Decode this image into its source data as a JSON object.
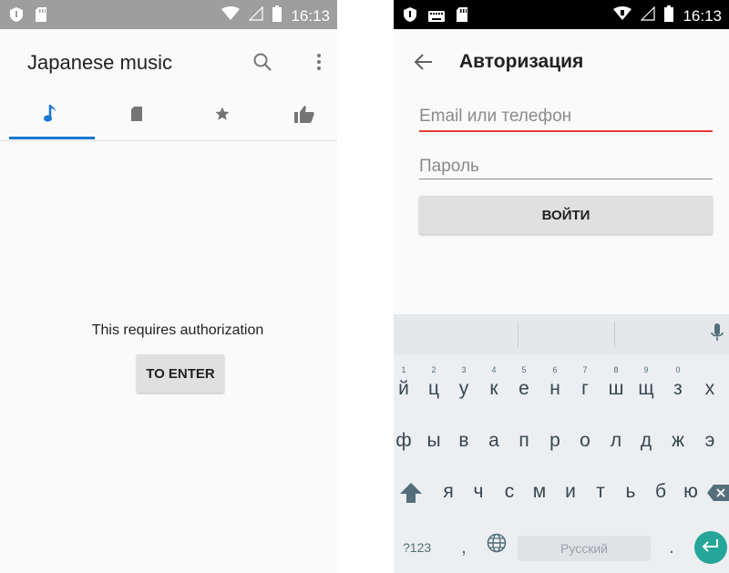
{
  "left": {
    "status_time": "16:13",
    "title": "Japanese music",
    "tabs": [
      {
        "icon": "music-note-icon"
      },
      {
        "icon": "sd-card-icon"
      },
      {
        "icon": "star-icon"
      },
      {
        "icon": "thumb-up-icon"
      }
    ],
    "message": "This requires authorization",
    "button_label": "TO ENTER",
    "accent": "#1976d2"
  },
  "right": {
    "status_time": "16:13",
    "title": "Авторизация",
    "email_placeholder": "Email или телефон",
    "password_placeholder": "Пароль",
    "login_label": "ВОЙТИ",
    "keyboard": {
      "row1": [
        "й",
        "ц",
        "у",
        "к",
        "е",
        "н",
        "г",
        "ш",
        "щ",
        "з",
        "х"
      ],
      "row1_hints": [
        "1",
        "2",
        "3",
        "4",
        "5",
        "6",
        "7",
        "8",
        "9",
        "0",
        ""
      ],
      "row2": [
        "ф",
        "ы",
        "в",
        "а",
        "п",
        "р",
        "о",
        "л",
        "д",
        "ж",
        "э"
      ],
      "row3": [
        "я",
        "ч",
        "с",
        "м",
        "и",
        "т",
        "ь",
        "б",
        "ю"
      ],
      "symbols_label": "?123",
      "comma": ",",
      "space_label": "Русский",
      "period": "."
    },
    "error_color": "#e53935",
    "enter_color": "#26a69a"
  }
}
